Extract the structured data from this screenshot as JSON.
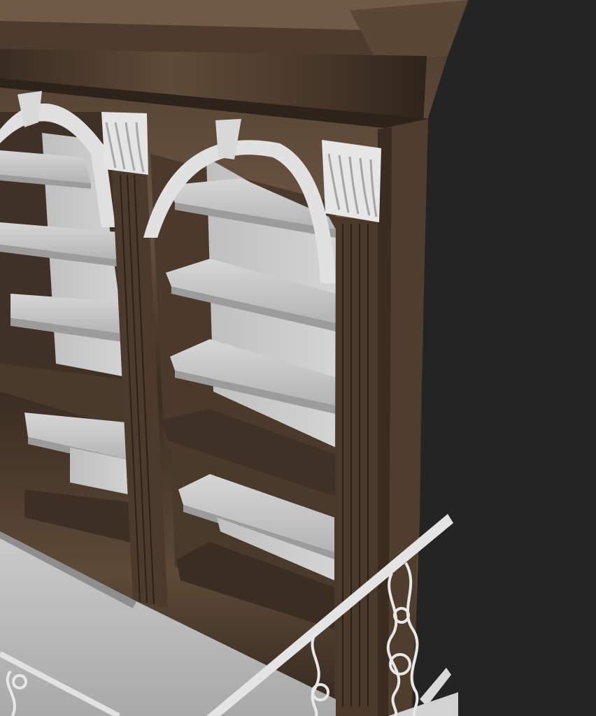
{
  "scene": {
    "subject": "bookcase-3d-render",
    "colors": {
      "background": "#242424",
      "wood_dark": "#3b2d22",
      "wood_mid": "#5a4736",
      "wood_light": "#7a6552",
      "shelf": "#c9c9c9",
      "shelf_shadow": "#9c9c9c",
      "trim": "#e2e2e2",
      "floor": "#bdbdbd"
    }
  }
}
